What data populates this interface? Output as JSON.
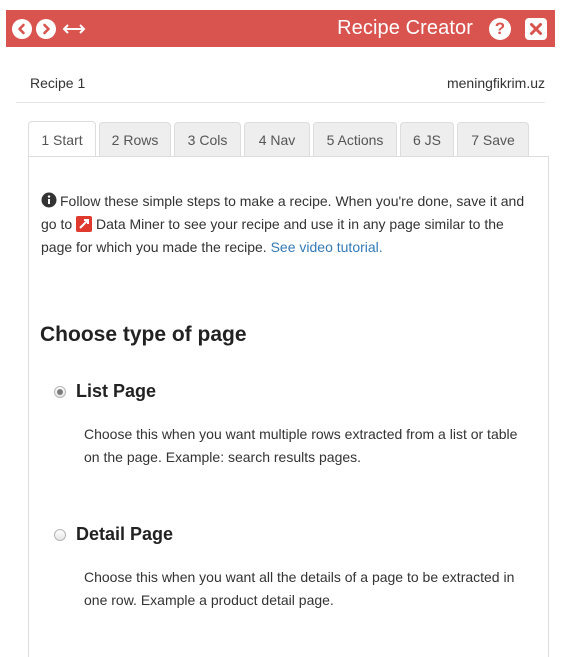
{
  "header": {
    "title": "Recipe Creator",
    "accent_color": "#d9534f",
    "back_icon": "chevron-left-icon",
    "forward_icon": "chevron-right-icon",
    "resize_icon": "horizontal-resize-icon",
    "help_label": "?",
    "close_icon": "close-icon"
  },
  "info": {
    "recipe_name": "Recipe 1",
    "domain": "meningfikrim.uz"
  },
  "tabs": [
    {
      "label": "1 Start",
      "active": true
    },
    {
      "label": "2 Rows",
      "active": false
    },
    {
      "label": "3 Cols",
      "active": false
    },
    {
      "label": "4 Nav",
      "active": false
    },
    {
      "label": "5 Actions",
      "active": false
    },
    {
      "label": "6 JS",
      "active": false
    },
    {
      "label": "7 Save",
      "active": false
    }
  ],
  "intro": {
    "part1": "Follow these simple steps to make a recipe. When you're done, save it and go to",
    "data_miner": "Data Miner",
    "part2": "to see your recipe and use it in any page similar to the page for which you made the recipe.",
    "link": "See video tutorial."
  },
  "section": {
    "title": "Choose type of page"
  },
  "options": [
    {
      "label": "List Page",
      "checked": true,
      "description": "Choose this when you want multiple rows extracted from a list or table on the page. Example: search results pages."
    },
    {
      "label": "Detail Page",
      "checked": false,
      "description": "Choose this when you want all the details of a page to be extracted in one row. Example a product detail page."
    }
  ]
}
